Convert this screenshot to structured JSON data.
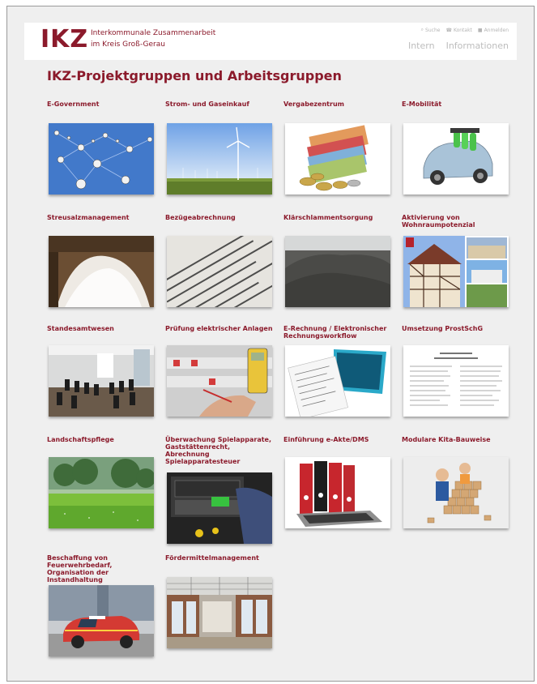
{
  "header": {
    "logo": "IKZ",
    "logo_sub_line1": "Interkommunale Zusammenarbeit",
    "logo_sub_line2": "im Kreis Groß-Gerau",
    "util_search": "Suche",
    "util_contact": "Kontakt",
    "util_login": "Anmelden",
    "nav_intern": "Intern",
    "nav_info": "Informationen"
  },
  "page": {
    "title": "IKZ-Projektgruppen und Arbeitsgruppen"
  },
  "cards": [
    {
      "title": "E-Government",
      "image": "network-spheres"
    },
    {
      "title": "Strom- und Gaseinkauf",
      "image": "wind-turbines"
    },
    {
      "title": "Vergabezentrum",
      "image": "euro-money"
    },
    {
      "title": "E-Mobilität",
      "image": "electric-car"
    },
    {
      "title": "Streusalzmanagement",
      "image": "salt-pile"
    },
    {
      "title": "Bezügeabrechnung",
      "image": "payroll-text"
    },
    {
      "title": "Klärschlammentsorgung",
      "image": "sludge"
    },
    {
      "title": "Aktivierung von Wohnraumpotenzial",
      "image": "half-timbered-houses"
    },
    {
      "title": "Standesamtwesen",
      "image": "wedding-hall"
    },
    {
      "title": "Prüfung elektrischer Anlagen",
      "image": "electrical-test"
    },
    {
      "title": "E-Rechnung / Elektronischer Rechnungsworkflow",
      "image": "e-invoice"
    },
    {
      "title": "Umsetzung ProstSchG",
      "image": "law-document"
    },
    {
      "title": "Landschaftspflege",
      "image": "meadow-trees"
    },
    {
      "title": "Überwachung Spielapparate, Gaststättenrecht, Abrechnung Spielapparatesteuer",
      "image": "slot-machine"
    },
    {
      "title": "Einführung e-Akte/DMS",
      "image": "binders-laptop"
    },
    {
      "title": "Modulare Kita-Bauweise",
      "image": "kids-blocks"
    },
    {
      "title": "Beschaffung von Feuerwehrbedarf, Organisation der Instandhaltung",
      "image": "fire-car"
    },
    {
      "title": "Fördermittelmanagement",
      "image": "loft-hall"
    }
  ]
}
